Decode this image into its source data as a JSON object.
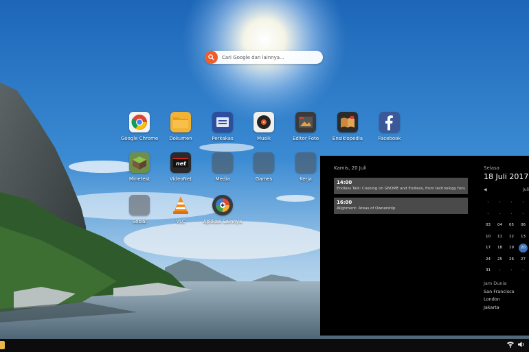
{
  "search": {
    "placeholder": "Cari Google dan lainnya..."
  },
  "apps": [
    {
      "id": "chrome",
      "label": "Google Chrome",
      "icon": "chrome-icon"
    },
    {
      "id": "dokumen",
      "label": "Dokumen",
      "icon": "folder-icon"
    },
    {
      "id": "perkakas",
      "label": "Perkakas",
      "icon": "toolbox-icon"
    },
    {
      "id": "musik",
      "label": "Musik",
      "icon": "music-record-icon"
    },
    {
      "id": "editor-foto",
      "label": "Editor Foto",
      "icon": "photo-editor-icon"
    },
    {
      "id": "ensiklopedia",
      "label": "Ensiklopedia",
      "icon": "book-icon"
    },
    {
      "id": "facebook",
      "label": "Facebook",
      "icon": "facebook-icon"
    },
    {
      "id": "minetest",
      "label": "Minetest",
      "icon": "minetest-icon"
    },
    {
      "id": "videonet",
      "label": "VideoNet",
      "icon": "videonet-icon"
    },
    {
      "id": "media",
      "label": "Media",
      "icon": "media-folder-icon"
    },
    {
      "id": "games",
      "label": "Games",
      "icon": "games-folder-icon"
    },
    {
      "id": "kerja",
      "label": "Kerja",
      "icon": "work-folder-icon"
    },
    {
      "id": "sosial",
      "label": "Sosial",
      "icon": "social-folder-icon"
    },
    {
      "id": "vlc",
      "label": "VLC",
      "icon": "vlc-icon"
    },
    {
      "id": "add-app",
      "label": "Aplikasi Lainnya",
      "icon": "add-app-icon"
    }
  ],
  "panel": {
    "events_date": "Kamis, 20 Juli",
    "events": [
      {
        "time": "14:00",
        "desc": "Endless Talk: Cooking on GNOME and Endless, from technology focu..."
      },
      {
        "time": "16:00",
        "desc": "Alignment: Areas of Ownership"
      }
    ],
    "weekday": "Selasa",
    "date": "18 Juli 2017",
    "month": "Juli",
    "prev_icon": "chevron-left-icon",
    "weeks": [
      [
        "",
        "",
        "",
        ""
      ],
      [
        "",
        "",
        "",
        ""
      ],
      [
        "03",
        "04",
        "05",
        "06"
      ],
      [
        "10",
        "11",
        "12",
        "13"
      ],
      [
        "17",
        "18",
        "19",
        "20"
      ],
      [
        "24",
        "25",
        "26",
        "27"
      ],
      [
        "31",
        "",
        "",
        ""
      ]
    ],
    "today": "20",
    "world_clocks_title": "Jam Dunia",
    "world_clocks": [
      "San Francisco",
      "London",
      "Jakarta"
    ]
  },
  "taskbar": {
    "network_icon": "network-icon",
    "volume_icon": "volume-icon"
  },
  "colors": {
    "search_accent": "#ef5d2a",
    "today": "#3d72b8",
    "panel_bg": "#000000"
  }
}
